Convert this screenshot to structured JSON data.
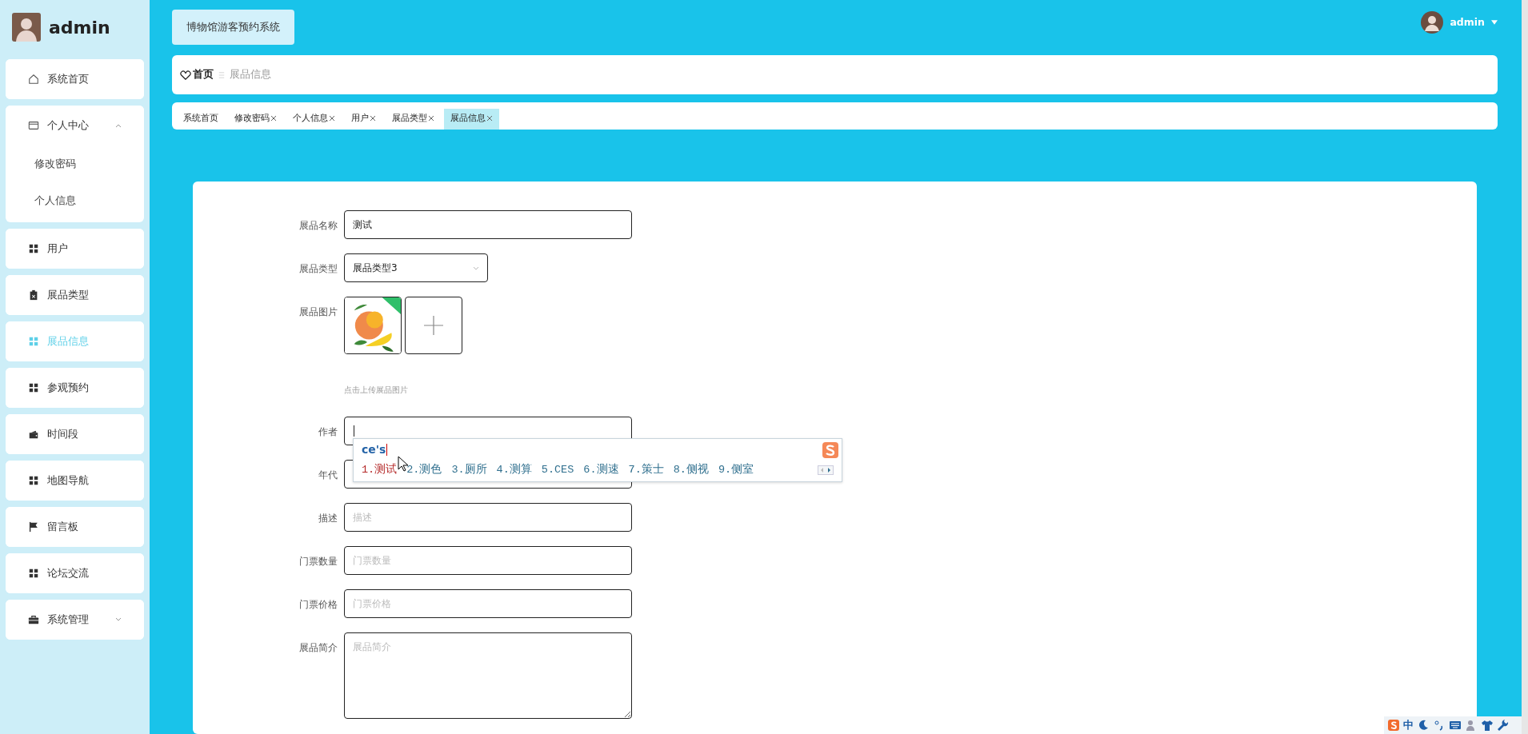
{
  "sidebar": {
    "user": "admin",
    "items": [
      {
        "label": "系统首页",
        "kind": "home",
        "selected": false
      },
      {
        "label": "个人中心",
        "kind": "card",
        "selected": false,
        "expanded": true,
        "children": [
          {
            "label": "修改密码",
            "selected": false
          },
          {
            "label": "个人信息",
            "selected": false
          }
        ]
      },
      {
        "label": "用户",
        "kind": "grid",
        "selected": false
      },
      {
        "label": "展品类型",
        "kind": "clipboard",
        "selected": false
      },
      {
        "label": "展品信息",
        "kind": "grid",
        "selected": true
      },
      {
        "label": "参观预约",
        "kind": "grid",
        "selected": false
      },
      {
        "label": "时间段",
        "kind": "wallet",
        "selected": false
      },
      {
        "label": "地图导航",
        "kind": "grid",
        "selected": false
      },
      {
        "label": "留言板",
        "kind": "flag",
        "selected": false
      },
      {
        "label": "论坛交流",
        "kind": "grid",
        "selected": false
      },
      {
        "label": "系统管理",
        "kind": "briefcase",
        "selected": false,
        "expanded": false
      }
    ]
  },
  "header": {
    "title": "博物馆游客预约系统",
    "user": "admin"
  },
  "breadcrumb": [
    {
      "label": "首页",
      "kind": "home"
    },
    {
      "label": "展品信息",
      "kind": "current"
    }
  ],
  "tabs": [
    {
      "label": "系统首页",
      "closable": false,
      "selected": false
    },
    {
      "label": "修改密码",
      "closable": true,
      "selected": false
    },
    {
      "label": "个人信息",
      "closable": true,
      "selected": false
    },
    {
      "label": "用户",
      "closable": true,
      "selected": false
    },
    {
      "label": "展品类型",
      "closable": true,
      "selected": false
    },
    {
      "label": "展品信息",
      "closable": true,
      "selected": true
    }
  ],
  "form": {
    "fields": [
      {
        "label": "展品名称",
        "kind": "text",
        "value": "测试"
      },
      {
        "label": "展品类型",
        "kind": "select",
        "value": "展品类型3"
      },
      {
        "label": "展品图片",
        "kind": "upload",
        "hint": "点击上传展品图片"
      },
      {
        "label": "作者",
        "kind": "text",
        "focused": true
      },
      {
        "label": "年代",
        "kind": "text"
      },
      {
        "label": "描述",
        "kind": "text",
        "placeholder": "描述"
      },
      {
        "label": "门票数量",
        "kind": "text",
        "placeholder": "门票数量"
      },
      {
        "label": "门票价格",
        "kind": "text",
        "placeholder": "门票价格"
      },
      {
        "label": "展品简介",
        "kind": "textarea",
        "placeholder": "展品简介"
      }
    ]
  },
  "ime": {
    "composition": "ce's",
    "candidates": [
      {
        "text": "1.测试",
        "selected": true
      },
      {
        "text": "2.测色",
        "selected": false
      },
      {
        "text": "3.厕所",
        "selected": false
      },
      {
        "text": "4.测算",
        "selected": false
      },
      {
        "text": "5.CES",
        "selected": false
      },
      {
        "text": "6.测速",
        "selected": false
      },
      {
        "text": "7.策士",
        "selected": false
      },
      {
        "text": "8.侧视",
        "selected": false
      },
      {
        "text": "9.侧室",
        "selected": false
      }
    ]
  },
  "tray": {
    "language": "中"
  }
}
